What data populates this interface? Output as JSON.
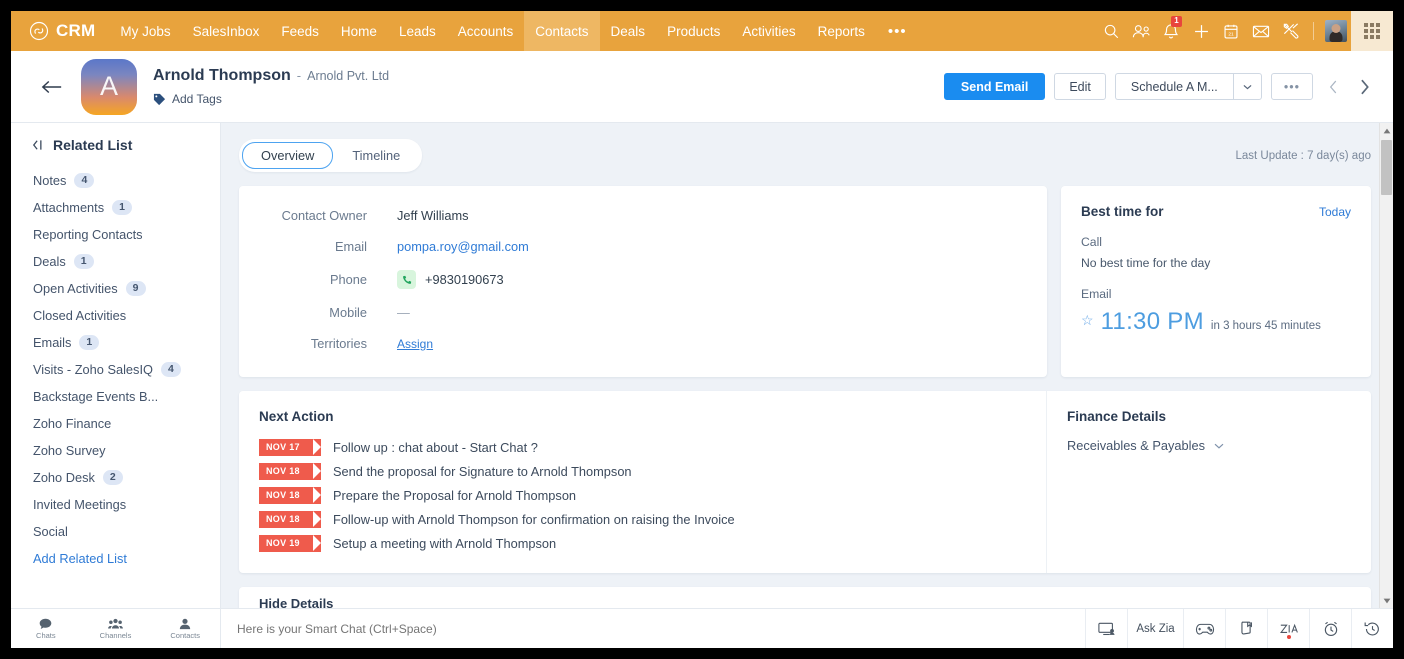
{
  "topnav": {
    "brand": "CRM",
    "brand_icon": "zoho-crm-logo-icon",
    "items": [
      {
        "label": "My Jobs",
        "active": false
      },
      {
        "label": "SalesInbox",
        "active": false
      },
      {
        "label": "Feeds",
        "active": false
      },
      {
        "label": "Home",
        "active": false
      },
      {
        "label": "Leads",
        "active": false
      },
      {
        "label": "Accounts",
        "active": false
      },
      {
        "label": "Contacts",
        "active": true
      },
      {
        "label": "Deals",
        "active": false
      },
      {
        "label": "Products",
        "active": false
      },
      {
        "label": "Activities",
        "active": false
      },
      {
        "label": "Reports",
        "active": false
      }
    ],
    "more_label": "•••",
    "icons": [
      "search-icon",
      "add-user-icon",
      "notifications-bell-icon",
      "plus-icon",
      "calendar-icon",
      "envelope-icon",
      "setup-tools-icon"
    ],
    "notification_count": "1",
    "calendar_day": "21",
    "accent_color": "#e8a33d",
    "active_tab_color": "#eeb763"
  },
  "record": {
    "back_icon": "back-arrow-icon",
    "avatar_letter": "A",
    "name": "Arnold Thompson",
    "separator": "-",
    "company": "Arnold Pvt. Ltd",
    "add_tags_label": "Add Tags",
    "tag_icon": "tag-icon",
    "actions": {
      "send_email": "Send Email",
      "edit": "Edit",
      "schedule": "Schedule A M...",
      "schedule_caret_icon": "chevron-down-icon",
      "more": "•••",
      "prev_icon": "chevron-left-icon",
      "next_icon": "chevron-right-icon"
    },
    "primary_color": "#1a8cf0"
  },
  "sidebar": {
    "collapse_icon": "collapse-panel-icon",
    "title": "Related List",
    "items": [
      {
        "label": "Notes",
        "count": "4"
      },
      {
        "label": "Attachments",
        "count": "1"
      },
      {
        "label": "Reporting Contacts",
        "count": ""
      },
      {
        "label": "Deals",
        "count": "1"
      },
      {
        "label": "Open Activities",
        "count": "9"
      },
      {
        "label": "Closed Activities",
        "count": ""
      },
      {
        "label": "Emails",
        "count": "1"
      },
      {
        "label": "Visits - Zoho SalesIQ",
        "count": "4"
      },
      {
        "label": "Backstage Events B...",
        "count": ""
      },
      {
        "label": "Zoho Finance",
        "count": ""
      },
      {
        "label": "Zoho Survey",
        "count": ""
      },
      {
        "label": "Zoho Desk",
        "count": "2"
      },
      {
        "label": "Invited Meetings",
        "count": ""
      },
      {
        "label": "Social",
        "count": ""
      }
    ],
    "add_related_list": "Add Related List"
  },
  "main": {
    "tabs": [
      {
        "label": "Overview",
        "active": true
      },
      {
        "label": "Timeline",
        "active": false
      }
    ],
    "last_update": "Last Update : 7 day(s) ago",
    "details": {
      "fields": [
        {
          "label": "Contact Owner",
          "value": "Jeff Williams",
          "type": "text"
        },
        {
          "label": "Email",
          "value": "pompa.roy@gmail.com",
          "type": "link"
        },
        {
          "label": "Phone",
          "value": "+9830190673",
          "type": "phone"
        },
        {
          "label": "Mobile",
          "value": "—",
          "type": "empty"
        },
        {
          "label": "Territories",
          "value": "Assign",
          "type": "assign"
        }
      ],
      "phone_icon": "phone-icon"
    },
    "best_time": {
      "title": "Best time for",
      "today_label": "Today",
      "call_label": "Call",
      "call_value": "No best time for the day",
      "email_label": "Email",
      "star_icon": "star-icon",
      "email_time": "11:30 PM",
      "email_in": "in 3 hours 45 minutes",
      "time_color": "#4d9de0"
    },
    "next_action": {
      "title": "Next Action",
      "items": [
        {
          "date": "NOV 17",
          "text": "Follow up : chat about - Start Chat ?"
        },
        {
          "date": "NOV 18",
          "text": "Send the proposal for Signature to Arnold Thompson"
        },
        {
          "date": "NOV 18",
          "text": "Prepare the Proposal for Arnold Thompson"
        },
        {
          "date": "NOV 18",
          "text": "Follow-up with Arnold Thompson for confirmation on raising the Invoice"
        },
        {
          "date": "NOV 19",
          "text": "Setup a meeting with Arnold Thompson"
        }
      ],
      "ribbon_color": "#ef5b4c"
    },
    "finance": {
      "title": "Finance Details",
      "row_label": "Receivables & Payables",
      "chevron_icon": "chevron-down-icon"
    },
    "next_card_peek": "Hide Details",
    "scrollbar": {
      "up_icon": "scroll-up-arrow-icon",
      "down_icon": "scroll-down-arrow-icon"
    }
  },
  "bottombar": {
    "chat_tabs": [
      {
        "label": "Chats",
        "icon": "chat-bubble-icon"
      },
      {
        "label": "Channels",
        "icon": "channels-group-icon"
      },
      {
        "label": "Contacts",
        "icon": "contact-person-icon"
      }
    ],
    "smartchat_placeholder": "Here is your Smart Chat (Ctrl+Space)",
    "right_icons": [
      {
        "name": "screen-share-icon",
        "label": ""
      },
      {
        "name": "ask-zia-label",
        "label": "Ask Zia"
      },
      {
        "name": "gamification-icon",
        "label": ""
      },
      {
        "name": "notes-flag-icon",
        "label": ""
      },
      {
        "name": "zia-icon",
        "label": "Zia"
      },
      {
        "name": "reminder-clock-icon",
        "label": ""
      },
      {
        "name": "recent-history-icon",
        "label": ""
      }
    ]
  }
}
